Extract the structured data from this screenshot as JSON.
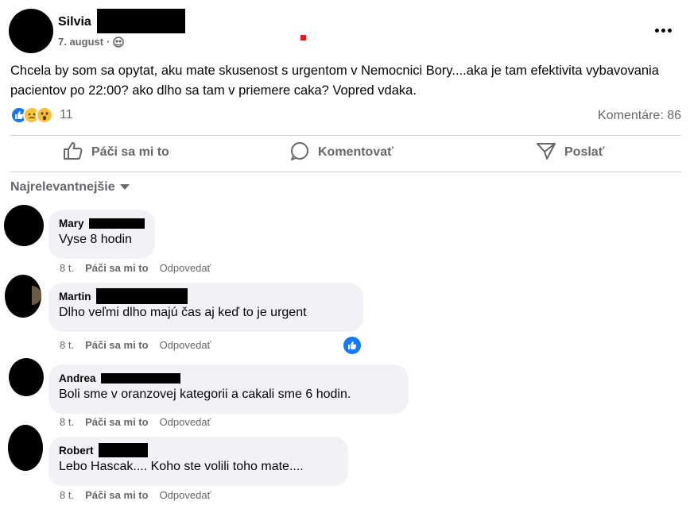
{
  "post": {
    "author_first": "Silvia",
    "date": "7. august",
    "separator": "·",
    "text": "Chcela by som sa opytat, aku mate skusenost s urgentom v Nemocnici Bory....aka je tam efektivita vybavovania pacientov po 22:00? ako dlho sa tam v priemere caka? Vopred vdaka.",
    "reaction_count": "11",
    "comments_label": "Komentáre: 86"
  },
  "actions": {
    "like": "Páči sa mi to",
    "comment": "Komentovať",
    "share": "Poslať"
  },
  "sort_label": "Najrelevantnejšie",
  "comments": [
    {
      "name": "Mary",
      "text": "Vyse 8 hodin",
      "time": "8 t.",
      "like": "Páči sa mi to",
      "reply": "Odpovedať"
    },
    {
      "name": "Martin",
      "text": "Dlho veľmi dlho majú čas aj keď to je urgent",
      "time": "8 t.",
      "like": "Páči sa mi to",
      "reply": "Odpovedať"
    },
    {
      "name": "Andrea",
      "text": "Boli sme v oranzovej kategorii a cakali sme 6 hodin.",
      "time": "8 t.",
      "like": "Páči sa mi to",
      "reply": "Odpovedať"
    },
    {
      "name": "Robert",
      "text": "Lebo Hascak.... Koho ste volili toho mate....",
      "time": "8 t.",
      "like": "Páči sa mi to",
      "reply": "Odpovedať"
    }
  ],
  "colors": {
    "accent": "#1877f2",
    "secondary_text": "#65676b",
    "bubble": "#f0f2f5"
  },
  "icons": [
    "more-icon",
    "globe-icon",
    "like-reaction-icon",
    "sad-reaction-icon",
    "wow-reaction-icon",
    "thumbs-up-icon",
    "comment-icon",
    "share-icon",
    "caret-down-icon"
  ]
}
